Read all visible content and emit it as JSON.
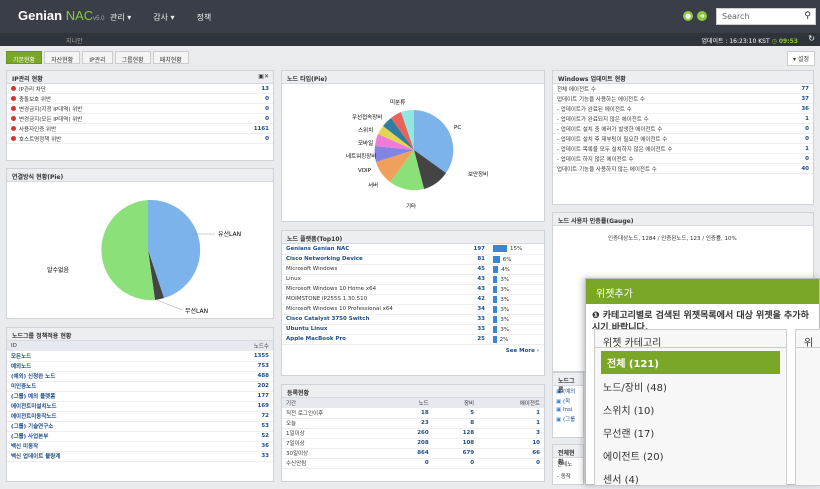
{
  "header": {
    "logo": "Genian",
    "logo_nac": "NAC",
    "logo_ver": "v5.0",
    "nav": [
      "관리 ▾",
      "감사 ▾",
      "정책"
    ],
    "search_placeholder": "Search",
    "user": "지니안",
    "time_label": "업데이트 : 16:23:10 KST",
    "time_val": "◷ 09:53"
  },
  "tabs": [
    "기본현황",
    "자산현황",
    "IP관리",
    "그룹현황",
    "패치현황"
  ],
  "settings_label": "▾ 설정",
  "ipmgmt": {
    "title": "IP관리 현황",
    "rows": [
      {
        "label": "IP관리 차단",
        "value": "13",
        "color": "#d9342b"
      },
      {
        "label": "충돌보호 위반",
        "value": "0",
        "color": "#d9342b"
      },
      {
        "label": "변경금지(지정 IP대역) 위반",
        "value": "0",
        "color": "#d9342b"
      },
      {
        "label": "변경금지(모든 IP대역) 위반",
        "value": "0",
        "color": "#d9342b"
      },
      {
        "label": "사용자인증 위반",
        "value": "1161",
        "color": "#d9342b"
      },
      {
        "label": "호스트명정책 위반",
        "value": "0",
        "color": "#d9342b"
      }
    ]
  },
  "connpie": {
    "title": "연결방식 현황(Pie)",
    "labels": [
      "유선LAN",
      "알수없음",
      "무선LAN"
    ]
  },
  "nodetype": {
    "title": "노드 타입(Pie)",
    "labels": [
      "미분류",
      "PC",
      "우선접속장비",
      "스위치",
      "모바일",
      "네트워킹장비",
      "VOIP",
      "서버",
      "기타",
      "보안장비"
    ]
  },
  "group": {
    "title": "노드그룹 정책적용 현황",
    "col_id": "ID",
    "col_count": "노드수",
    "rows": [
      [
        "모든노드",
        "1355"
      ],
      [
        "예외노드",
        "753"
      ],
      [
        "(예외) 신청완 노드",
        "488"
      ],
      [
        "미인증노드",
        "202"
      ],
      [
        "(그룹) 예외 플랫폼",
        "177"
      ],
      [
        "에이전트미설치노드",
        "169"
      ],
      [
        "에이전트미동작노드",
        "72"
      ],
      [
        "(그룹) 기술연구소",
        "53"
      ],
      [
        "(그룹) 사업본부",
        "52"
      ],
      [
        "백신 미동작",
        "36"
      ],
      [
        "백신 업데이트 불량계",
        "33"
      ]
    ]
  },
  "platform": {
    "title": "노드 플랫폼(Top10)",
    "rows": [
      {
        "name": "Genians Genian NAC",
        "n": "197",
        "p": "15%",
        "bold": true,
        "f": 15
      },
      {
        "name": "Cisco Networking Device",
        "n": "81",
        "p": "6%",
        "bold": true,
        "f": 6
      },
      {
        "name": "Microsoft Windows",
        "n": "45",
        "p": "4%",
        "bold": false,
        "f": 4
      },
      {
        "name": "Linux",
        "n": "43",
        "p": "3%",
        "bold": false,
        "f": 3
      },
      {
        "name": "Microsoft Windows 10 Home x64",
        "n": "43",
        "p": "3%",
        "bold": false,
        "f": 3
      },
      {
        "name": "MOIMSTONE IP255S 1.30.510",
        "n": "42",
        "p": "3%",
        "bold": false,
        "f": 3
      },
      {
        "name": "Microsoft Windows 10 Professional x64",
        "n": "34",
        "p": "3%",
        "bold": false,
        "f": 3
      },
      {
        "name": "Cisco Catalyst 3750 Switch",
        "n": "33",
        "p": "3%",
        "bold": true,
        "f": 3
      },
      {
        "name": "Ubuntu Linux",
        "n": "33",
        "p": "3%",
        "bold": true,
        "f": 3
      },
      {
        "name": "Apple MacBook Pro",
        "n": "25",
        "p": "2%",
        "bold": true,
        "f": 2
      }
    ],
    "more": "See More ›"
  },
  "reg": {
    "title": "등록현황",
    "cols": [
      "기간",
      "노드",
      "장비",
      "에이전트"
    ],
    "rows": [
      [
        "직전 로그인이후",
        "18",
        "5",
        "1"
      ],
      [
        "오늘",
        "23",
        "8",
        "1"
      ],
      [
        "1일이상",
        "260",
        "128",
        "3"
      ],
      [
        "7일이상",
        "208",
        "108",
        "10"
      ],
      [
        "30일이상",
        "864",
        "679",
        "66"
      ],
      [
        "수신안됨",
        "0",
        "0",
        "0"
      ]
    ]
  },
  "winupd": {
    "title": "Windows 업데이트 현황",
    "rows": [
      [
        "전체 에이전트 수",
        "77"
      ],
      [
        "업데이트 기능을 사용하는 에이전트 수",
        "37"
      ],
      [
        "- 업데이트가 완료된 에이전트 수",
        "36"
      ],
      [
        "- 업데이트가 완료되지 않은 에이전트 수",
        "1"
      ],
      [
        "- 업데이트 설치 중 에러가 발생한 에이전트 수",
        "0"
      ],
      [
        "- 업데이트 설치 후 재부팅이 필요한 에이전트 수",
        "0"
      ],
      [
        "- 업데이트 목록을 모두 설치하지 않은 에이전트 수",
        "1"
      ],
      [
        "- 업데이트 하지 않은 에이전트 수",
        "0"
      ],
      [
        "업데이트 기능을 사용하지 않는 에이전트 수",
        "40"
      ]
    ]
  },
  "gauge": {
    "title": "노드 사용자 인증률(Gauge)",
    "text": "인증대상노드, 1284 / 인증된노드, 123 / 인증률, 10%"
  },
  "nodegrp2": {
    "title": "노드그룹",
    "rows": [
      "(예외",
      "(학",
      "Insi",
      "(그룹"
    ]
  },
  "total": {
    "title": "전체현황",
    "rows": [
      "전체노",
      "- 동작"
    ]
  },
  "widget": {
    "title": "위젯추가",
    "desc": "❶ 카테고리별로 검색된 위젯목록에서 대상 위젯을 추가하시기 바랍니다.",
    "cat_header": "위젯 카테고리",
    "side_header": "위",
    "cats": [
      "전체 (121)",
      "노드/장비 (48)",
      "스위치 (10)",
      "무선랜 (17)",
      "에이전트 (20)",
      "센서 (4)"
    ]
  }
}
